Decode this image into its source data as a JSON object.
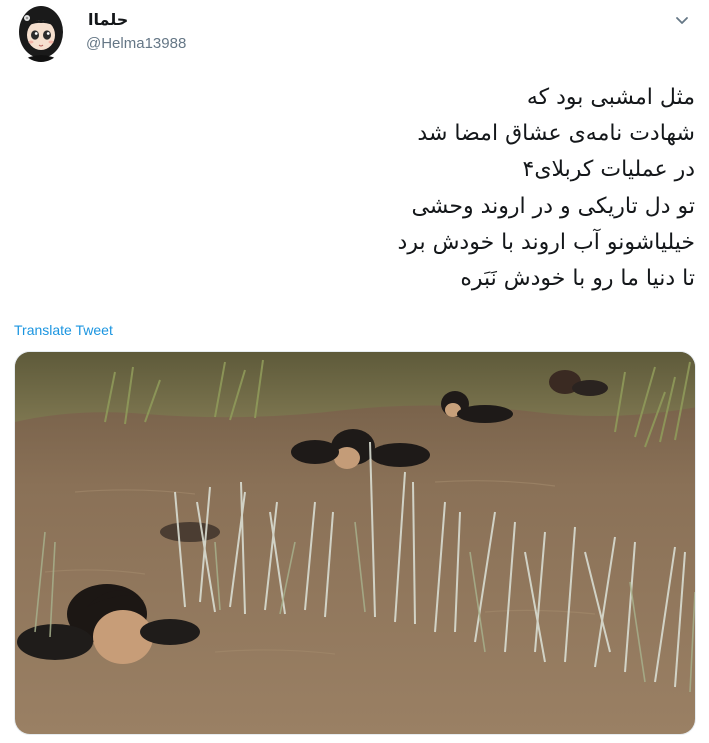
{
  "user": {
    "display_name": "حلماا",
    "handle": "@Helma13988"
  },
  "tweet": {
    "lines": [
      "مثل امشبی بود که",
      "شهادت نامه‌ی عشاق امضا شد",
      "در عملیات کربلای۴",
      "تو دل تاریکی و در اروند وحشی",
      "خیلیاشونو آب اروند با خودش برد",
      "تا دنیا ما رو با خودش نَبَره"
    ],
    "translate_label": "Translate Tweet"
  },
  "icons": {
    "caret": "chevron-down-icon",
    "avatar": "avatar"
  },
  "colors": {
    "text": "#14171a",
    "secondary": "#657786",
    "link": "#1b95e0",
    "water": "#8a7157"
  }
}
